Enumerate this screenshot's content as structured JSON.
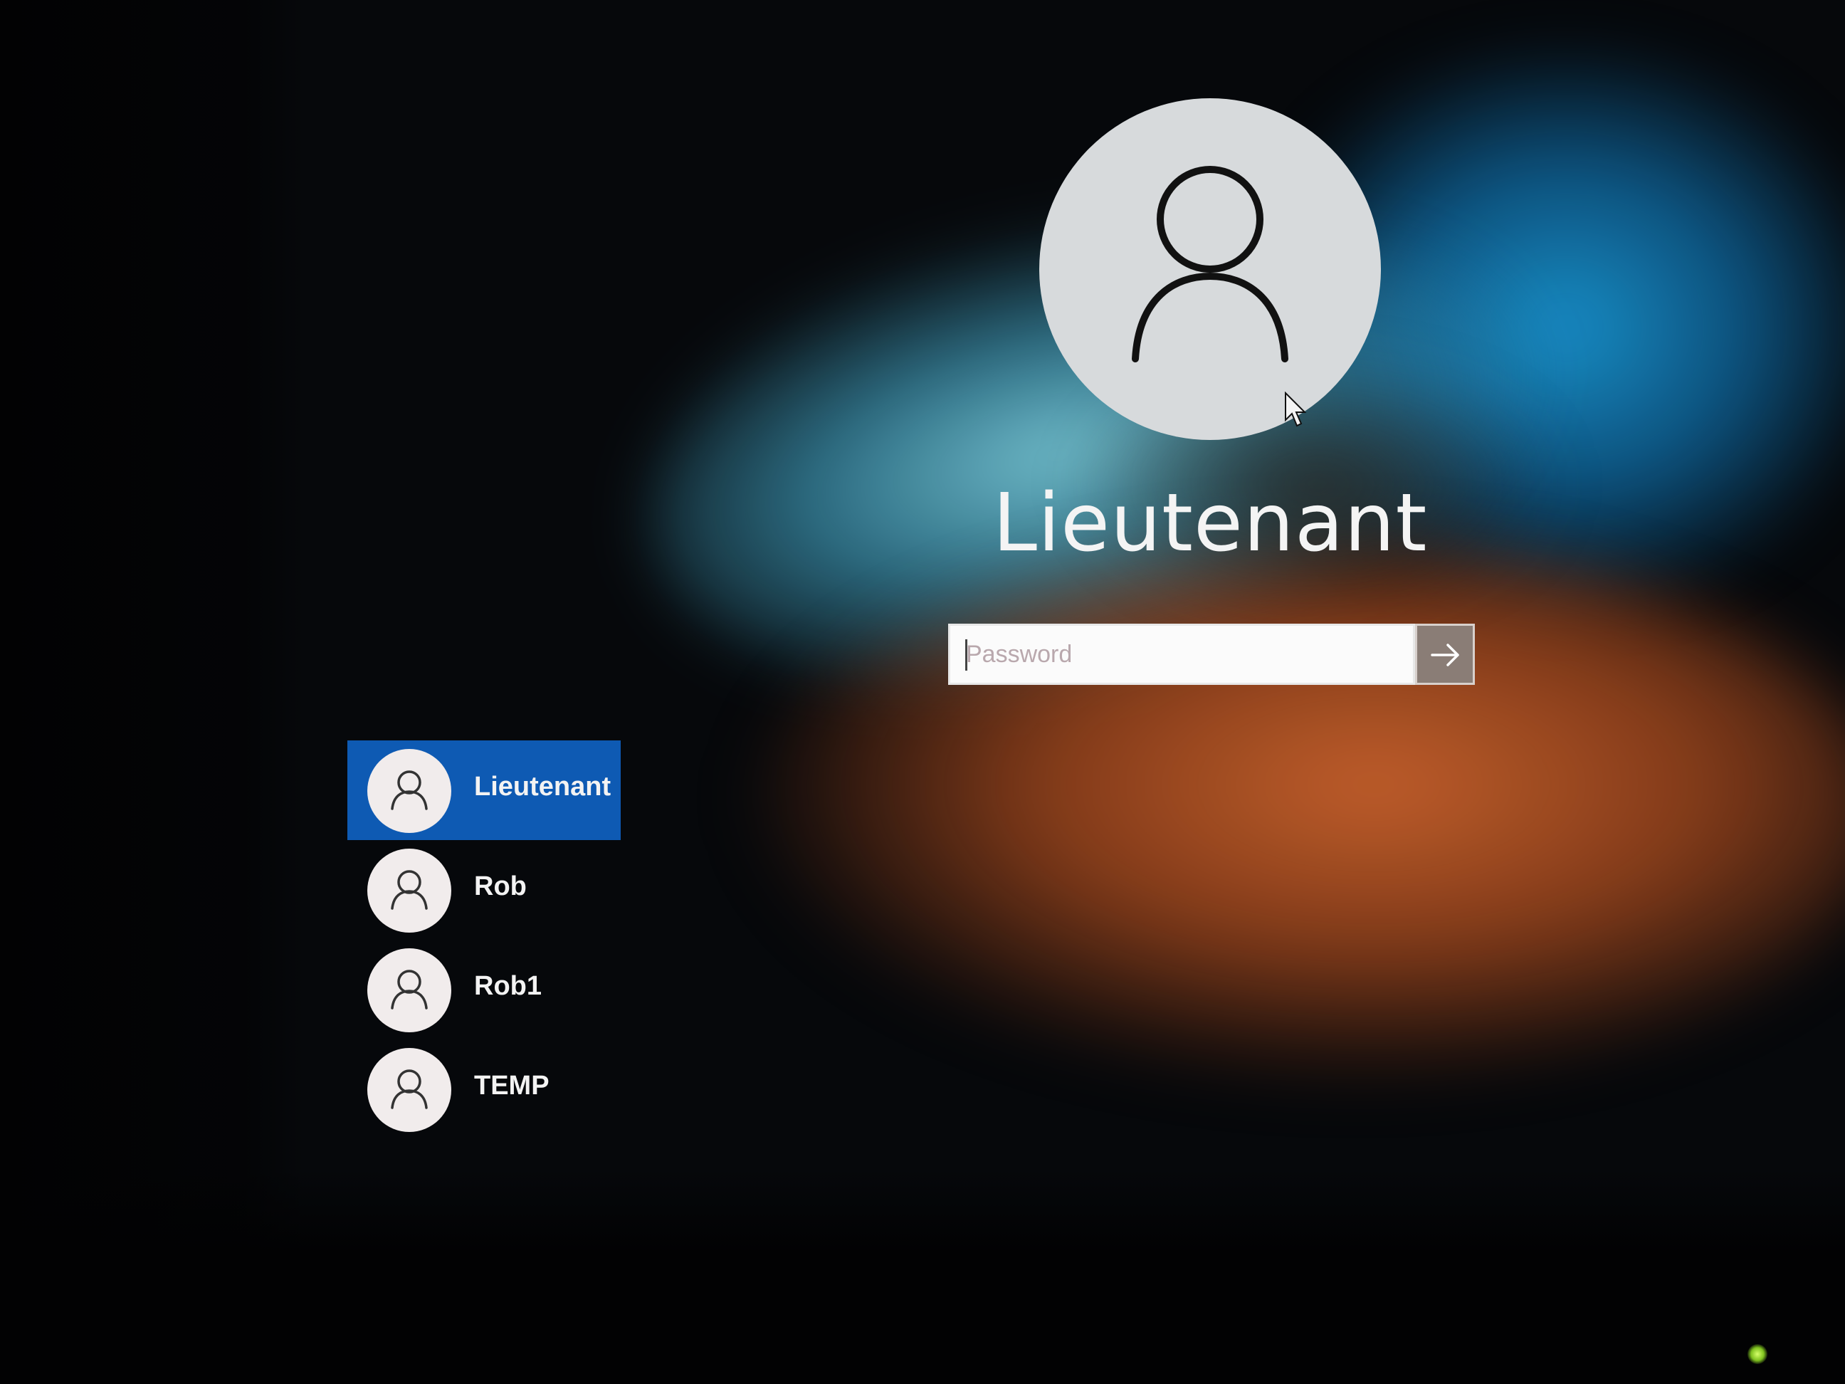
{
  "lock_screen": {
    "current_user": "Lieutenant",
    "password": {
      "placeholder": "Password",
      "value": "",
      "submit_icon": "arrow-right-icon"
    },
    "users": [
      {
        "name": "Lieutenant",
        "selected": true,
        "icon": "user-icon"
      },
      {
        "name": "Rob",
        "selected": false,
        "icon": "user-icon"
      },
      {
        "name": "Rob1",
        "selected": false,
        "icon": "user-icon"
      },
      {
        "name": "TEMP",
        "selected": false,
        "icon": "user-icon"
      }
    ]
  },
  "colors": {
    "selected_user_bg": "#0e5ab3",
    "avatar_bg": "#d7dadc",
    "submit_bg": "#8a7d76"
  }
}
